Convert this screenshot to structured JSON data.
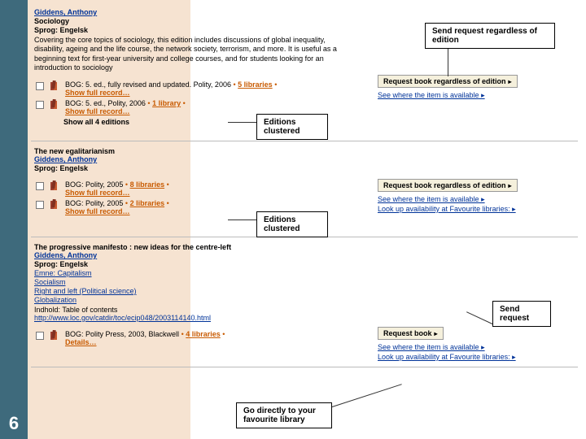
{
  "slide_number": "6",
  "records": [
    {
      "title": "Giddens, Anthony",
      "heading": "Sociology",
      "lang": "Sprog: Engelsk",
      "desc": "Covering the core topics of sociology, this edition includes discussions of global inequality, disability, ageing and the life course, the network society, terrorism, and more. It is useful as a beginning text for first-year university and college courses, and for students looking for an introduction to sociology",
      "editions": [
        {
          "text": "BOG: 5. ed., fully revised and updated. Polity, 2006",
          "lib": "5 libraries"
        },
        {
          "text": "BOG: 5. ed., Polity, 2006",
          "lib": "1 library"
        }
      ],
      "show_all": "Show all 4 editions",
      "show_full": "Show full record…",
      "request": {
        "label": "Request book regardless of edition",
        "links": [
          "See where the item is available"
        ]
      }
    },
    {
      "title": "The new egalitarianism",
      "author": "Giddens, Anthony",
      "lang": "Sprog: Engelsk",
      "editions": [
        {
          "text": "BOG: Polity, 2005",
          "lib": "8 libraries"
        },
        {
          "text": "BOG: Polity, 2005",
          "lib": "2 libraries"
        }
      ],
      "show_full": "Show full record…",
      "request": {
        "label": "Request book regardless of edition",
        "links": [
          "See where the item is available",
          "Look up availability at Favourite libraries:"
        ]
      }
    },
    {
      "title": "The progressive manifesto : new ideas for the centre-left",
      "author": "Giddens, Anthony",
      "lang": "Sprog: Engelsk",
      "subjects": [
        "Emne: Capitalism",
        "Socialism",
        "Right and left (Political science)",
        "Globalization"
      ],
      "indhold": "Indhold: Table of contents",
      "url": "http://www.loc.gov/catdir/toc/ecip048/2003114140.html",
      "editions": [
        {
          "text": "BOG: Polity Press, 2003, Blackwell",
          "lib": "4 libraries"
        }
      ],
      "details": "Details…",
      "request": {
        "label": "Request book",
        "links": [
          "See where the item is available",
          "Look up availability at Favourite libraries:"
        ]
      }
    }
  ],
  "callouts": {
    "c1": "Send request regardless of edition",
    "c2": "Editions clustered",
    "c3": "Editions clustered",
    "c4": "Send request",
    "c5": "Go directly to your favourite library"
  }
}
